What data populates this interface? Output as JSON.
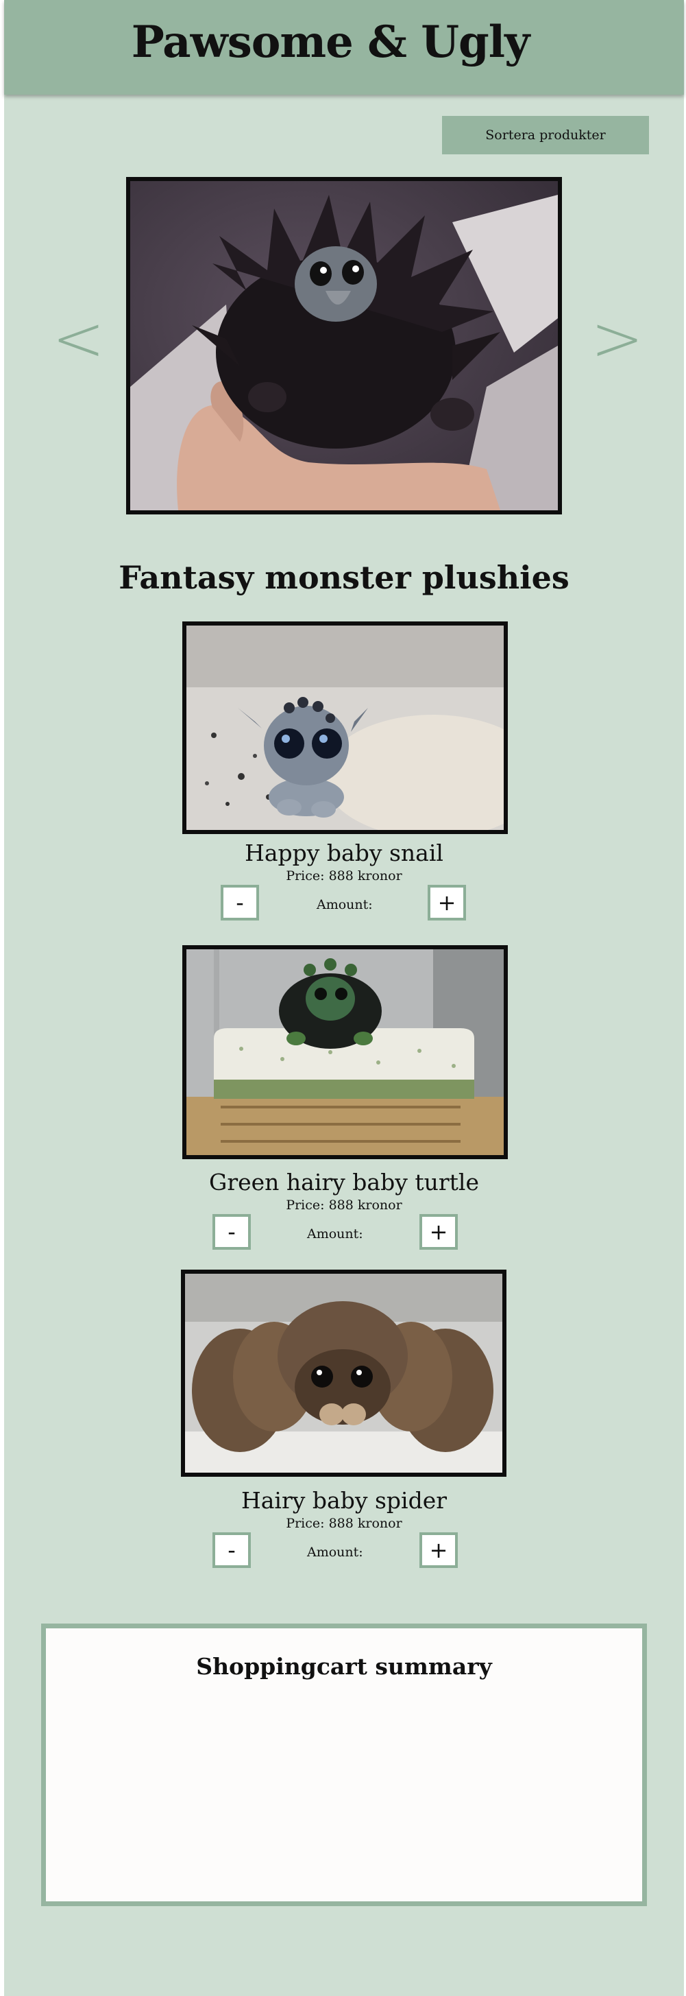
{
  "header": {
    "title": "Pawsome & Ugly"
  },
  "sort_button": {
    "label": "Sortera produkter"
  },
  "carousel": {
    "prev_label": "<",
    "next_label": ">"
  },
  "section": {
    "title": "Fantasy monster plushies"
  },
  "products": [
    {
      "name": "Happy baby snail",
      "price": "Price: 888 kronor",
      "amount_label": "Amount:",
      "minus": "-",
      "plus": "+"
    },
    {
      "name": "Green hairy baby turtle",
      "price": "Price: 888 kronor",
      "amount_label": "Amount:",
      "minus": "-",
      "plus": "+"
    },
    {
      "name": "Hairy baby spider",
      "price": "Price: 888 kronor",
      "amount_label": "Amount:",
      "minus": "-",
      "plus": "+"
    }
  ],
  "cart": {
    "title": "Shoppingcart summary"
  }
}
